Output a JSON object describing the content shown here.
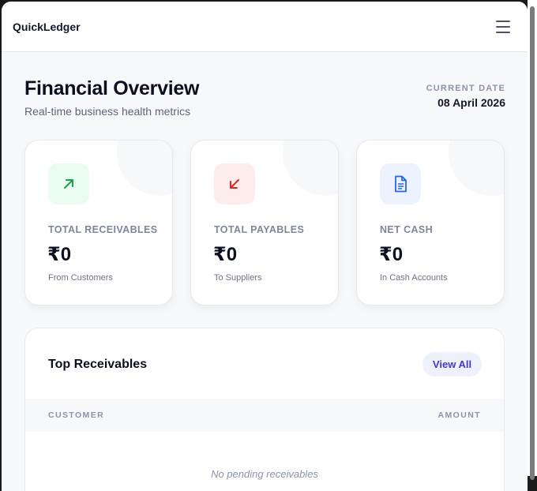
{
  "app": {
    "brand": "QuickLedger"
  },
  "header": {
    "title": "Financial Overview",
    "subtitle": "Real-time business health metrics",
    "date_label": "CURRENT DATE",
    "date_value": "08 April 2026"
  },
  "cards": [
    {
      "label": "TOTAL RECEIVABLES",
      "value": "₹0",
      "caption": "From Customers",
      "icon": "arrow-up-right-icon",
      "accent": "#16a34a",
      "icon_bg": "#eafbf0"
    },
    {
      "label": "TOTAL PAYABLES",
      "value": "₹0",
      "caption": "To Suppliers",
      "icon": "arrow-down-left-icon",
      "accent": "#dc2626",
      "icon_bg": "#fdecec"
    },
    {
      "label": "NET CASH",
      "value": "₹0",
      "caption": "In Cash Accounts",
      "icon": "document-icon",
      "accent": "#2563eb",
      "icon_bg": "#ecf2fe"
    }
  ],
  "receivables": {
    "title": "Top Receivables",
    "view_all_label": "View All",
    "columns": [
      "CUSTOMER",
      "AMOUNT"
    ],
    "empty_text": "No pending receivables"
  },
  "colors": {
    "accent": "#4338ca",
    "background": "#f7f8fa"
  }
}
